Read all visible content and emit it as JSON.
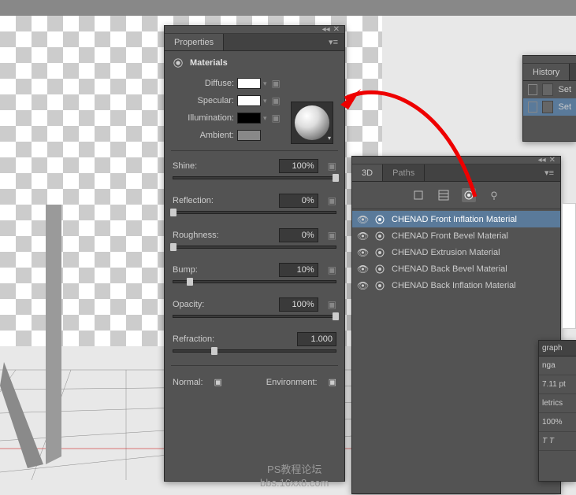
{
  "properties": {
    "tab_label": "Properties",
    "section_title": "Materials",
    "rows": {
      "diffuse": "Diffuse:",
      "specular": "Specular:",
      "illumination": "Illumination:",
      "ambient": "Ambient:"
    },
    "sliders": {
      "shine": {
        "label": "Shine:",
        "value": "100%",
        "pos": 100
      },
      "reflection": {
        "label": "Reflection:",
        "value": "0%",
        "pos": 0
      },
      "roughness": {
        "label": "Roughness:",
        "value": "0%",
        "pos": 0
      },
      "bump": {
        "label": "Bump:",
        "value": "10%",
        "pos": 10
      },
      "opacity": {
        "label": "Opacity:",
        "value": "100%",
        "pos": 100
      },
      "refraction": {
        "label": "Refraction:",
        "value": "1.000",
        "pos": 25
      }
    },
    "bottom": {
      "normal": "Normal:",
      "environment": "Environment:"
    }
  },
  "panel3d": {
    "tabs": {
      "active": "3D",
      "inactive": "Paths"
    },
    "items": [
      "CHENAD Front Inflation Material",
      "CHENAD Front Bevel Material",
      "CHENAD Extrusion Material",
      "CHENAD Back Bevel Material",
      "CHENAD Back Inflation Material"
    ]
  },
  "history": {
    "tab": "History",
    "items": [
      "Set",
      "Set"
    ]
  },
  "charpanel": {
    "tab": "graph",
    "rows": [
      "nga",
      "7.11 pt",
      "letrics",
      "100%"
    ]
  },
  "watermark": {
    "line1": "PS教程论坛",
    "line2": "bbs.16xx8.com"
  }
}
